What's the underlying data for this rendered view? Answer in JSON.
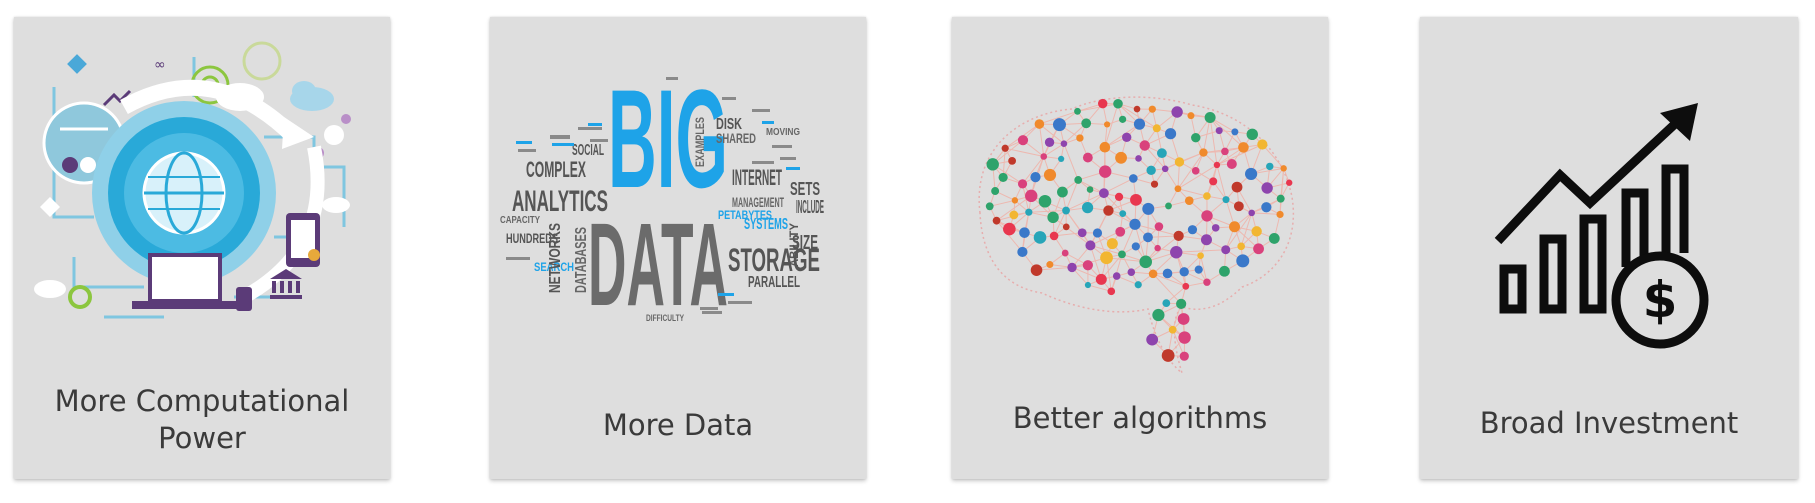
{
  "cards": [
    {
      "caption": "More Computational Power",
      "icon": "computational-power-illustration"
    },
    {
      "caption": "More Data",
      "icon": "big-data-word-cloud"
    },
    {
      "caption": "Better algorithms",
      "icon": "neural-network-brain"
    },
    {
      "caption": "Broad Investment",
      "icon": "investment-growth-chart"
    }
  ],
  "wordcloud": {
    "big": "BIG",
    "data": "DATA",
    "analytics": "ANALYTICS",
    "complex": "COMPLEX",
    "storage": "STORAGE",
    "internet": "INTERNET",
    "management": "MANAGEMENT",
    "systems": "SYSTEMS",
    "social": "SOCIAL",
    "include": "INCLUDE",
    "size": "SIZE",
    "sets": "SETS",
    "networks": "NETWORKS",
    "databases": "DATABASES",
    "parallel": "PARALLEL",
    "hundreds": "HUNDREDS",
    "petabytes": "PETABYTES",
    "disk": "DISK",
    "shared": "SHARED",
    "ability": "ABILITY",
    "searching": "SEARCH",
    "capacity": "CAPACITY",
    "examples": "EXAMPLES",
    "moving": "MOVING",
    "difficulty": "DIFFICULTY"
  },
  "colors": {
    "card_bg": "#dedede",
    "caption_text": "#3a3a3a",
    "big_blue": "#1ea3e8",
    "data_gray": "#6b6b6b",
    "pc_blue": "#29a9d8",
    "pc_purple": "#5b3b78",
    "pc_green": "#8cc63f"
  }
}
